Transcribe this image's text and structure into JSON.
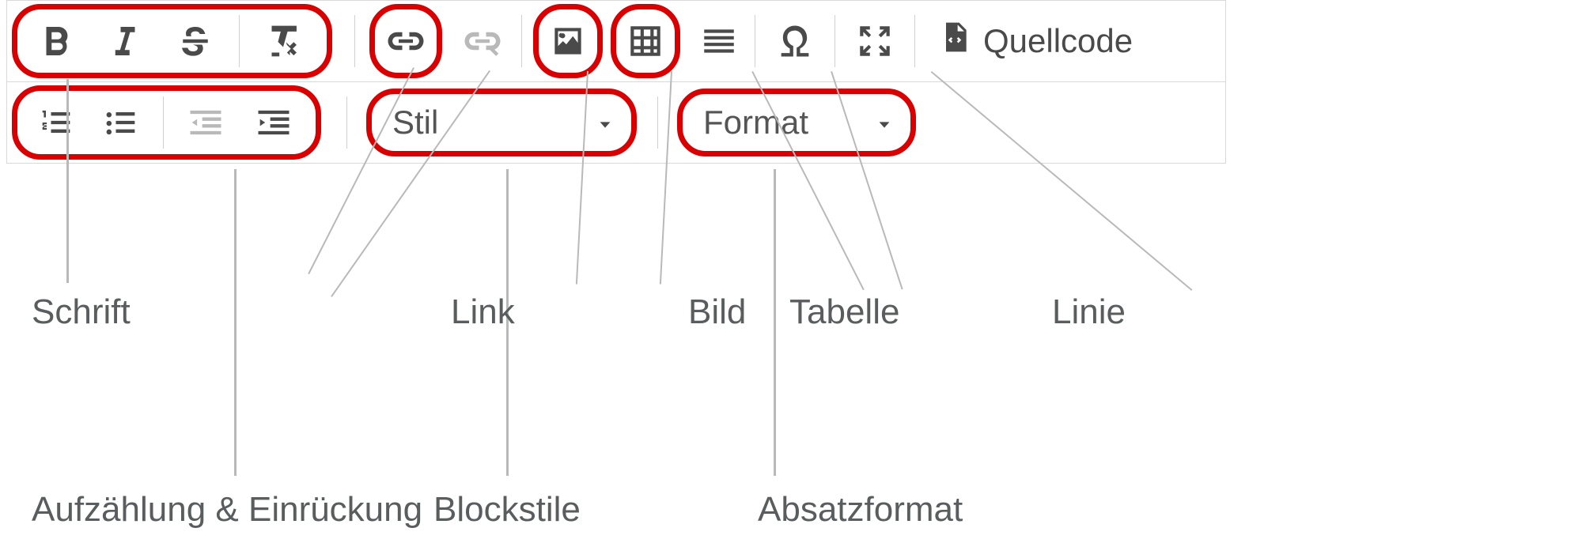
{
  "toolbar": {
    "row1": {
      "style_dropdown_label": "Stil",
      "format_dropdown_label": "Format"
    },
    "source_button_label": "Quellcode",
    "icons": {
      "bold": "bold-icon",
      "italic": "italic-icon",
      "strike": "strikethrough-icon",
      "removefmt": "remove-format-icon",
      "link": "link-icon",
      "unlink": "unlink-icon",
      "image": "image-icon",
      "table": "table-icon",
      "hr": "horizontal-rule-icon",
      "omega": "special-char-icon",
      "maximize": "maximize-icon",
      "source": "source-icon",
      "ol": "ordered-list-icon",
      "ul": "unordered-list-icon",
      "outdent": "outdent-icon",
      "indent": "indent-icon"
    }
  },
  "annotations": {
    "schrift": "Schrift",
    "link": "Link",
    "bild": "Bild",
    "tabelle": "Tabelle",
    "linie": "Linie",
    "aufzaehlung": "Aufzählung & Einrückung",
    "blockstile": "Blockstile",
    "absatzformat": "Absatzformat"
  }
}
